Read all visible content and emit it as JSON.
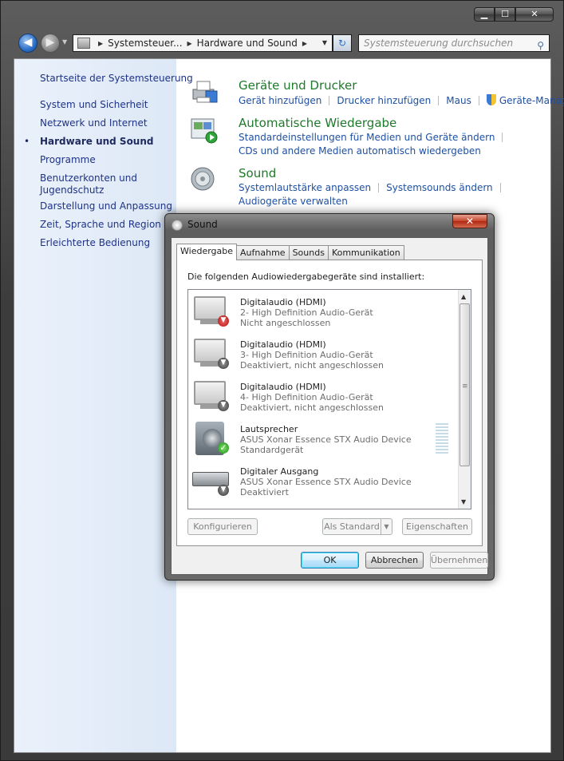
{
  "window": {
    "buttons": {
      "minimize": "▁",
      "maximize": "☐",
      "close": "✕"
    }
  },
  "address_bar": {
    "crumbs": [
      "Systemsteuer...",
      "Hardware und Sound"
    ],
    "search_placeholder": "Systemsteuerung durchsuchen"
  },
  "sidebar": {
    "home": "Startseite der Systemsteuerung",
    "items": [
      {
        "label": "System und Sicherheit"
      },
      {
        "label": "Netzwerk und Internet"
      },
      {
        "label": "Hardware und Sound",
        "active": true
      },
      {
        "label": "Programme"
      },
      {
        "label": "Benutzerkonten und Jugendschutz"
      },
      {
        "label": "Darstellung und Anpassung"
      },
      {
        "label": "Zeit, Sprache und Region"
      },
      {
        "label": "Erleichterte Bedienung"
      }
    ],
    "bullet": "•"
  },
  "sections": [
    {
      "title": "Geräte und Drucker",
      "links": [
        "Gerät hinzufügen",
        "Drucker hinzufügen",
        "Maus",
        "Geräte-Manager"
      ]
    },
    {
      "title": "Automatische Wiedergabe",
      "links": [
        "Standardeinstellungen für Medien und Geräte ändern",
        "CDs und andere Medien automatisch wiedergeben"
      ]
    },
    {
      "title": "Sound",
      "links": [
        "Systemlautstärke anpassen",
        "Systemsounds ändern",
        "Audiogeräte verwalten"
      ]
    }
  ],
  "sound_dialog": {
    "title": "Sound",
    "close": "✕",
    "tabs": [
      "Wiedergabe",
      "Aufnahme",
      "Sounds",
      "Kommunikation"
    ],
    "active_tab": "Wiedergabe",
    "caption": "Die folgenden Audiowiedergabegeräte sind installiert:",
    "devices": [
      {
        "name": "Digitalaudio (HDMI)",
        "desc": "2- High Definition Audio-Gerät",
        "status": "Nicht angeschlossen",
        "icon": "monitor-icon",
        "badge": "red-down-arrow"
      },
      {
        "name": "Digitalaudio (HDMI)",
        "desc": "3- High Definition Audio-Gerät",
        "status": "Deaktiviert, nicht angeschlossen",
        "icon": "monitor-icon",
        "badge": "gray-down-arrow"
      },
      {
        "name": "Digitalaudio (HDMI)",
        "desc": "4- High Definition Audio-Gerät",
        "status": "Deaktiviert, nicht angeschlossen",
        "icon": "monitor-icon",
        "badge": "gray-down-arrow"
      },
      {
        "name": "Lautsprecher",
        "desc": "ASUS Xonar Essence STX Audio Device",
        "status": "Standardgerät",
        "icon": "speaker-icon",
        "badge": "green-check"
      },
      {
        "name": "Digitaler Ausgang",
        "desc": "ASUS Xonar Essence STX Audio Device",
        "status": "Deaktiviert",
        "icon": "spdif-icon",
        "badge": "gray-down-arrow"
      }
    ],
    "buttons": {
      "configure": "Konfigurieren",
      "set_default": "Als Standard",
      "properties": "Eigenschaften",
      "ok": "OK",
      "cancel": "Abbrechen",
      "apply": "Übernehmen"
    }
  },
  "colors": {
    "link_blue": "#1e50a2",
    "section_green": "#1e7a2a",
    "sidebar_bg": "#e4edf9"
  }
}
